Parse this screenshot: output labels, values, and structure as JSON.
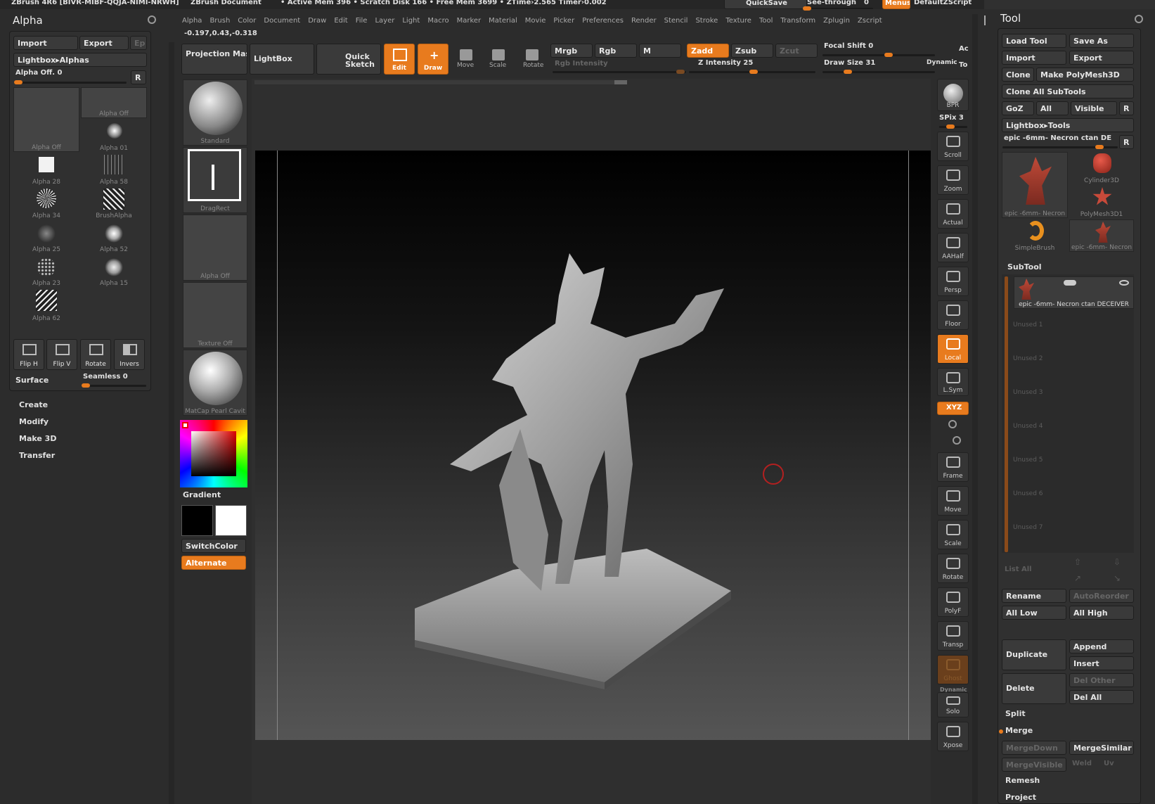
{
  "titlebar": {
    "app": "ZBrush 4R6 [BIVR-MIBF-QQJA-NIMI-NRWH]",
    "doc": "ZBrush Document",
    "stats": "• Active Mem 396 • Scratch Disk 166 • Free Mem 3699 • ZTime›2.565 Timer›0.002",
    "quicksave": "QuickSave",
    "seethrough": "See-through",
    "seethrough_val": "0",
    "menus": "Menus",
    "script": "DefaultZScript"
  },
  "menubar": [
    "Alpha",
    "Brush",
    "Color",
    "Document",
    "Draw",
    "Edit",
    "File",
    "Layer",
    "Light",
    "Macro",
    "Marker",
    "Material",
    "Movie",
    "Picker",
    "Preferences",
    "Render",
    "Stencil",
    "Stroke",
    "Texture",
    "Tool",
    "Transform",
    "Zplugin",
    "Zscript"
  ],
  "coords": "-0.197,0.43,-0.318",
  "toolbar": {
    "projection": "Projection Master",
    "lightbox": "LightBox",
    "quicksketch": "Quick Sketch",
    "edit": "Edit",
    "draw": "Draw",
    "move": "Move",
    "scale": "Scale",
    "rotate": "Rotate",
    "mrgb": "Mrgb",
    "rgb": "Rgb",
    "m": "M",
    "rgb_intensity": "Rgb Intensity",
    "zadd": "Zadd",
    "zsub": "Zsub",
    "zcut": "Zcut",
    "z_intensity": "Z Intensity 25",
    "focal_shift": "Focal Shift 0",
    "draw_size": "Draw Size 31",
    "dynamic": "Dynamic",
    "ac": "Ac",
    "to": "To"
  },
  "alpha_panel": {
    "title": "Alpha",
    "import": "Import",
    "export": "Export",
    "ep": "Ep",
    "lightbox_alphas": "Lightbox▸Alphas",
    "alpha_off_slider": "Alpha Off. 0",
    "r": "R",
    "tiles": [
      "Alpha Off",
      "Alpha Off",
      "Alpha 01",
      "Alpha 28",
      "Alpha 58",
      "Alpha 34",
      "BrushAlpha",
      "Alpha 25",
      "Alpha 52",
      "Alpha 23",
      "Alpha 15",
      "Alpha 62"
    ],
    "flip_h": "Flip H",
    "flip_v": "Flip V",
    "rotate": "Rotate",
    "invers": "Invers",
    "surface": "Surface",
    "seamless": "Seamless 0",
    "create": "Create",
    "modify": "Modify",
    "make3d": "Make 3D",
    "transfer": "Transfer"
  },
  "left_shelf": {
    "brush": "Standard",
    "stroke": "DragRect",
    "alpha": "Alpha Off",
    "texture": "Texture Off",
    "material": "MatCap Pearl Cavit",
    "gradient": "Gradient",
    "switchcolor": "SwitchColor",
    "alternate": "Alternate"
  },
  "right_shelf": {
    "bpr": "BPR",
    "spix": "SPix 3",
    "scroll": "Scroll",
    "zoom": "Zoom",
    "actual": "Actual",
    "aahalf": "AAHalf",
    "persp": "Persp",
    "floor": "Floor",
    "local": "Local",
    "lsym": "L.Sym",
    "xyz": "XYZ",
    "frame": "Frame",
    "move": "Move",
    "scale": "Scale",
    "rotate": "Rotate",
    "polyf": "PolyF",
    "transp": "Transp",
    "ghost": "Ghost",
    "dynamic": "Dynamic",
    "solo": "Solo",
    "xpose": "Xpose"
  },
  "tool_panel": {
    "title": "Tool",
    "load_tool": "Load Tool",
    "save_as": "Save As",
    "import": "Import",
    "export": "Export",
    "clone": "Clone",
    "make_polymesh": "Make PolyMesh3D",
    "clone_all": "Clone All SubTools",
    "goz": "GoZ",
    "all": "All",
    "visible": "Visible",
    "r": "R",
    "lightbox_tools": "Lightbox▸Tools",
    "current_tool": "epic -6mm- Necron ctan DE",
    "r2": "R",
    "tiles": [
      "epic -6mm- Necron",
      "Cylinder3D",
      "PolyMesh3D1",
      "SimpleBrush",
      "epic -6mm- Necron"
    ],
    "subtool_header": "SubTool",
    "subtool_active": "epic -6mm- Necron ctan DECEIVER",
    "unused": [
      "Unused 1",
      "Unused 2",
      "Unused 3",
      "Unused 4",
      "Unused 5",
      "Unused 6",
      "Unused 7"
    ],
    "list_all": "List All",
    "rename": "Rename",
    "autoreorder": "AutoReorder",
    "all_low": "All Low",
    "all_high": "All High",
    "duplicate": "Duplicate",
    "append": "Append",
    "insert": "Insert",
    "delete": "Delete",
    "del_other": "Del Other",
    "del_all": "Del All",
    "split": "Split",
    "merge": "Merge",
    "mergedown": "MergeDown",
    "mergesimilar": "MergeSimilar",
    "mergevisible": "MergeVisible",
    "weld": "Weld",
    "uv": "Uv",
    "remesh": "Remesh",
    "project": "Project"
  },
  "accent": "#e87b1e"
}
